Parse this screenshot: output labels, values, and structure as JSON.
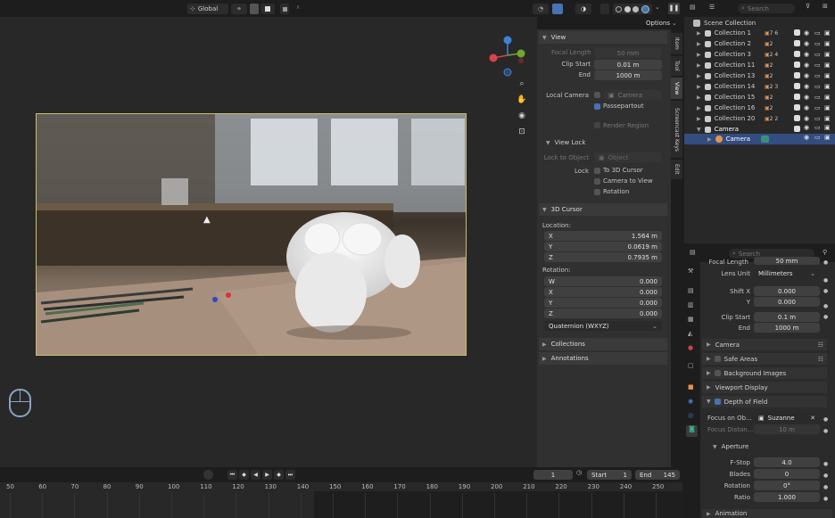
{
  "header": {
    "transform": "Global",
    "options": "Options",
    "search_placeholder": "Search"
  },
  "view_panel": {
    "title": "View",
    "focal_length_label": "Focal Length",
    "focal_length": "50 mm",
    "clip_start_label": "Clip Start",
    "clip_start": "0.01 m",
    "end_label": "End",
    "end": "1000 m",
    "local_camera_label": "Local Camera",
    "local_camera_value": "Camera",
    "passepartout": "Passepartout",
    "render_region": "Render Region",
    "view_lock": "View Lock",
    "lock_to_object_label": "Lock to Object",
    "lock_to_object_value": "Object",
    "lock_label": "Lock",
    "to_3d_cursor": "To 3D Cursor",
    "camera_to_view": "Camera to View",
    "rotation": "Rotation",
    "cursor_title": "3D Cursor",
    "location_label": "Location:",
    "loc": [
      {
        "k": "X",
        "v": "1.564 m"
      },
      {
        "k": "Y",
        "v": "0.0619 m"
      },
      {
        "k": "Z",
        "v": "0.7935 m"
      }
    ],
    "rotation_label": "Rotation:",
    "rot": [
      {
        "k": "W",
        "v": "0.000"
      },
      {
        "k": "X",
        "v": "0.000"
      },
      {
        "k": "Y",
        "v": "0.000"
      },
      {
        "k": "Z",
        "v": "0.000"
      }
    ],
    "rotation_mode": "Quaternion (WXYZ)",
    "collections": "Collections",
    "annotations": "Annotations"
  },
  "side_tabs": [
    "Item",
    "Tool",
    "View",
    "Screencast Keys",
    "Edit"
  ],
  "outliner": {
    "root": "Scene Collection",
    "items": [
      {
        "name": "Collection 1",
        "count": "7 6"
      },
      {
        "name": "Collection 2",
        "count": "2"
      },
      {
        "name": "Collection 3",
        "count": "2 4"
      },
      {
        "name": "Collection 11",
        "count": "2"
      },
      {
        "name": "Collection 13",
        "count": "2"
      },
      {
        "name": "Collection 14",
        "count": "2 3"
      },
      {
        "name": "Collection 15",
        "count": "2"
      },
      {
        "name": "Collection 16",
        "count": "2"
      },
      {
        "name": "Collection 20",
        "count": "2 2"
      }
    ],
    "camera_col": "Camera",
    "camera_obj": "Camera"
  },
  "properties": {
    "search_placeholder": "Search",
    "focal_length_label": "Focal Length",
    "focal_length": "50 mm",
    "lens_unit_label": "Lens Unit",
    "lens_unit": "Millimeters",
    "shift_x_label": "Shift X",
    "shift_x": "0.000",
    "shift_y_label": "Y",
    "shift_y": "0.000",
    "clip_start_label": "Clip Start",
    "clip_start": "0.1 m",
    "clip_end_label": "End",
    "clip_end": "1000 m",
    "camera": "Camera",
    "safe_areas": "Safe Areas",
    "background_images": "Background Images",
    "viewport_display": "Viewport Display",
    "dof": "Depth of Field",
    "focus_on_label": "Focus on Ob...",
    "focus_on": "Suzanne",
    "focus_distance_label": "Focus Distan...",
    "focus_distance": "10 m",
    "aperture": "Aperture",
    "fstop_label": "F-Stop",
    "fstop": "4.0",
    "blades_label": "Blades",
    "blades": "0",
    "rotation_label": "Rotation",
    "rotation": "0°",
    "ratio_label": "Ratio",
    "ratio": "1.000",
    "animation": "Animation"
  },
  "timeline": {
    "current": "1",
    "start_label": "Start",
    "start": "1",
    "end_label": "End",
    "end": "145",
    "ruler": [
      "50",
      "60",
      "70",
      "80",
      "90",
      "100",
      "110",
      "120",
      "130",
      "140",
      "150",
      "160",
      "170",
      "180",
      "190",
      "200",
      "210",
      "220",
      "230",
      "240",
      "250"
    ]
  },
  "colors": {
    "accent": "#4772b3",
    "selected": "#334d80",
    "axis_x": "#d9434b",
    "axis_y": "#70a82d",
    "axis_z": "#3d82d9"
  }
}
